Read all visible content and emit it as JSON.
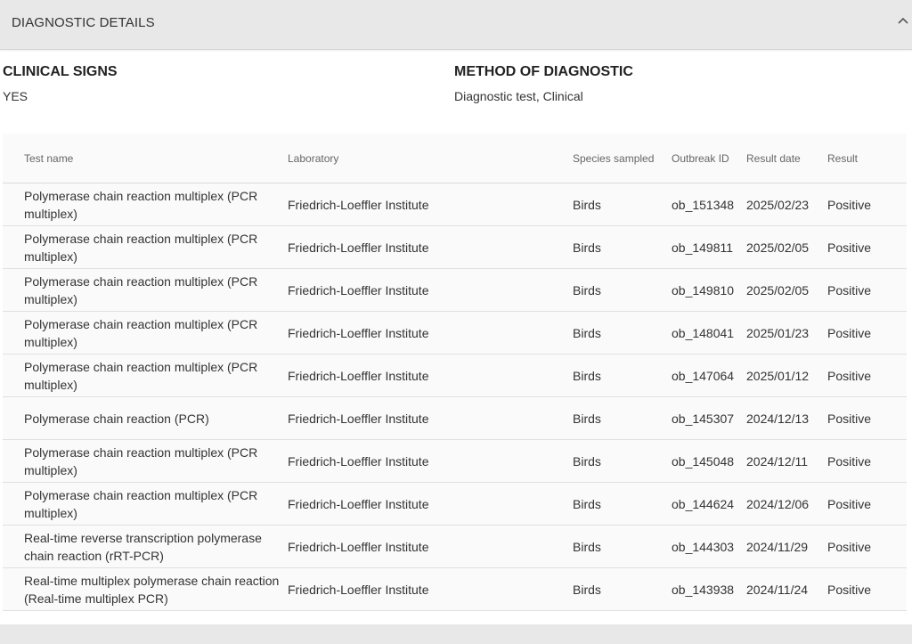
{
  "panel": {
    "title": "DIAGNOSTIC DETAILS",
    "toggle_icon": "chevron-up-icon"
  },
  "clinical_signs": {
    "label": "CLINICAL SIGNS",
    "value": "YES"
  },
  "method": {
    "label": "METHOD OF DIAGNOSTIC",
    "value": "Diagnostic test, Clinical"
  },
  "table": {
    "headers": [
      "Test name",
      "Laboratory",
      "Species sampled",
      "Outbreak ID",
      "Result date",
      "Result"
    ],
    "rows": [
      [
        "Polymerase chain reaction multiplex (PCR multiplex)",
        "Friedrich-Loeffler Institute",
        "Birds",
        "ob_151348",
        "2025/02/23",
        "Positive"
      ],
      [
        "Polymerase chain reaction multiplex (PCR multiplex)",
        "Friedrich-Loeffler Institute",
        "Birds",
        "ob_149811",
        "2025/02/05",
        "Positive"
      ],
      [
        "Polymerase chain reaction multiplex (PCR multiplex)",
        "Friedrich-Loeffler Institute",
        "Birds",
        "ob_149810",
        "2025/02/05",
        "Positive"
      ],
      [
        "Polymerase chain reaction multiplex (PCR multiplex)",
        "Friedrich-Loeffler Institute",
        "Birds",
        "ob_148041",
        "2025/01/23",
        "Positive"
      ],
      [
        "Polymerase chain reaction multiplex (PCR multiplex)",
        "Friedrich-Loeffler Institute",
        "Birds",
        "ob_147064",
        "2025/01/12",
        "Positive"
      ],
      [
        "Polymerase chain reaction (PCR)",
        "Friedrich-Loeffler Institute",
        "Birds",
        "ob_145307",
        "2024/12/13",
        "Positive"
      ],
      [
        "Polymerase chain reaction multiplex (PCR multiplex)",
        "Friedrich-Loeffler Institute",
        "Birds",
        "ob_145048",
        "2024/12/11",
        "Positive"
      ],
      [
        "Polymerase chain reaction multiplex (PCR multiplex)",
        "Friedrich-Loeffler Institute",
        "Birds",
        "ob_144624",
        "2024/12/06",
        "Positive"
      ],
      [
        "Real-time reverse transcription polymerase chain reaction (rRT-PCR)",
        "Friedrich-Loeffler Institute",
        "Birds",
        "ob_144303",
        "2024/11/29",
        "Positive"
      ],
      [
        "Real-time multiplex polymerase chain reaction (Real-time multiplex PCR)",
        "Friedrich-Loeffler Institute",
        "Birds",
        "ob_143938",
        "2024/11/24",
        "Positive"
      ]
    ]
  }
}
